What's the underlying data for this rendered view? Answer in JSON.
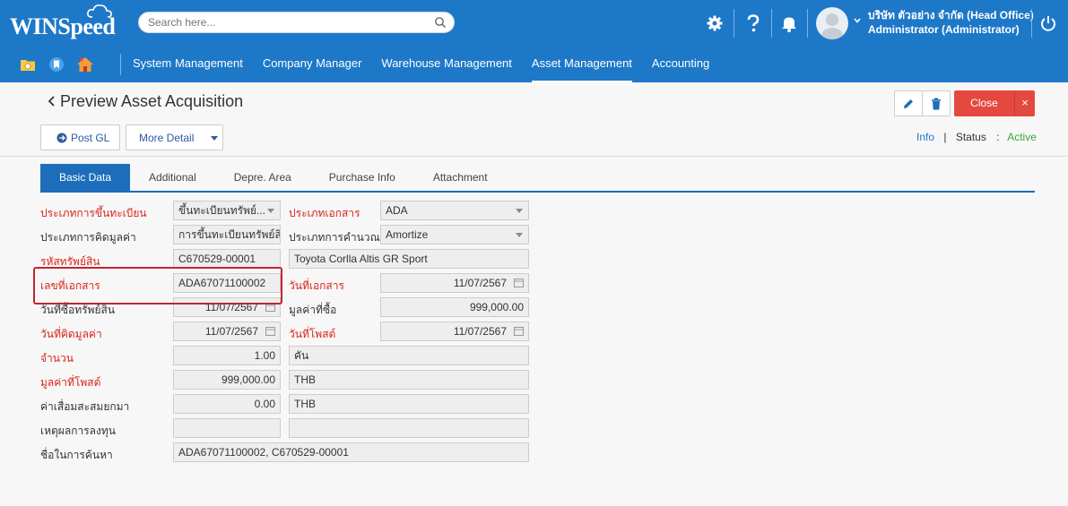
{
  "brand": {
    "logo_text": "WINSpeed"
  },
  "search": {
    "placeholder": "Search here..."
  },
  "user": {
    "company": "บริษัท ตัวอย่าง จำกัด (Head Office)",
    "name": "Administrator (Administrator)"
  },
  "nav": {
    "menu": [
      "System Management",
      "Company Manager",
      "Warehouse Management",
      "Asset Management",
      "Accounting"
    ],
    "active": "Asset Management"
  },
  "page": {
    "title": "Preview Asset Acquisition",
    "close_label": "Close",
    "close_x": "×"
  },
  "actions": {
    "post_gl": "Post GL",
    "more_detail": "More Detail"
  },
  "status_bar": {
    "info": "Info",
    "sep": "|",
    "status_label": "Status",
    "colon": ":",
    "status_value": "Active"
  },
  "tabs": [
    "Basic Data",
    "Additional",
    "Depre. Area",
    "Purchase Info",
    "Attachment"
  ],
  "form": {
    "reg_type_label": "ประเภทการขึ้นทะเบียน",
    "reg_type_value": "ขึ้นทะเบียนทรัพย์...",
    "doc_type_label": "ประเภทเอกสาร",
    "doc_type_value": "ADA",
    "valuation_type_label": "ประเภทการคิดมูลค่า",
    "valuation_type_value": "การขึ้นทะเบียนทรัพย์สิ",
    "calc_type_label": "ประเภทการคำนวณ",
    "calc_type_value": "Amortize",
    "asset_code_label": "รหัสทรัพย์สิน",
    "asset_code_value": "C670529-00001",
    "asset_name_value": "Toyota Corlla Altis GR Sport",
    "doc_no_label": "เลขที่เอกสาร",
    "doc_no_value": "ADA67071100002",
    "doc_date_label": "วันที่เอกสาร",
    "doc_date_value": "11/07/2567",
    "purchase_date_label": "วันที่ซื้อทรัพย์สิน",
    "purchase_date_value": "11/07/2567",
    "purchase_value_label": "มูลค่าที่ซื้อ",
    "purchase_value_value": "999,000.00",
    "valuation_date_label": "วันที่คิดมูลค่า",
    "valuation_date_value": "11/07/2567",
    "post_date_label": "วันที่โพสต์",
    "post_date_value": "11/07/2567",
    "qty_label": "จำนวน",
    "qty_value": "1.00",
    "unit_value": "คัน",
    "post_value_label": "มูลค่าที่โพสต์",
    "post_value_value": "999,000.00",
    "post_value_currency": "THB",
    "accum_dep_label": "ค่าเสื่อมสะสมยกมา",
    "accum_dep_value": "0.00",
    "accum_dep_currency": "THB",
    "invest_reason_label": "เหตุผลการลงทุน",
    "invest_reason_value": "",
    "invest_reason_value2": "",
    "search_name_label": "ชื่อในการค้นหา",
    "search_name_value": "ADA67071100002, C670529-00001"
  },
  "colors": {
    "primary": "#1e78c8",
    "tab_active": "#1e6dbb",
    "danger": "#e5483f",
    "required_label": "#d9261c",
    "status_active": "#3da43d",
    "highlight": "#c0272d"
  }
}
